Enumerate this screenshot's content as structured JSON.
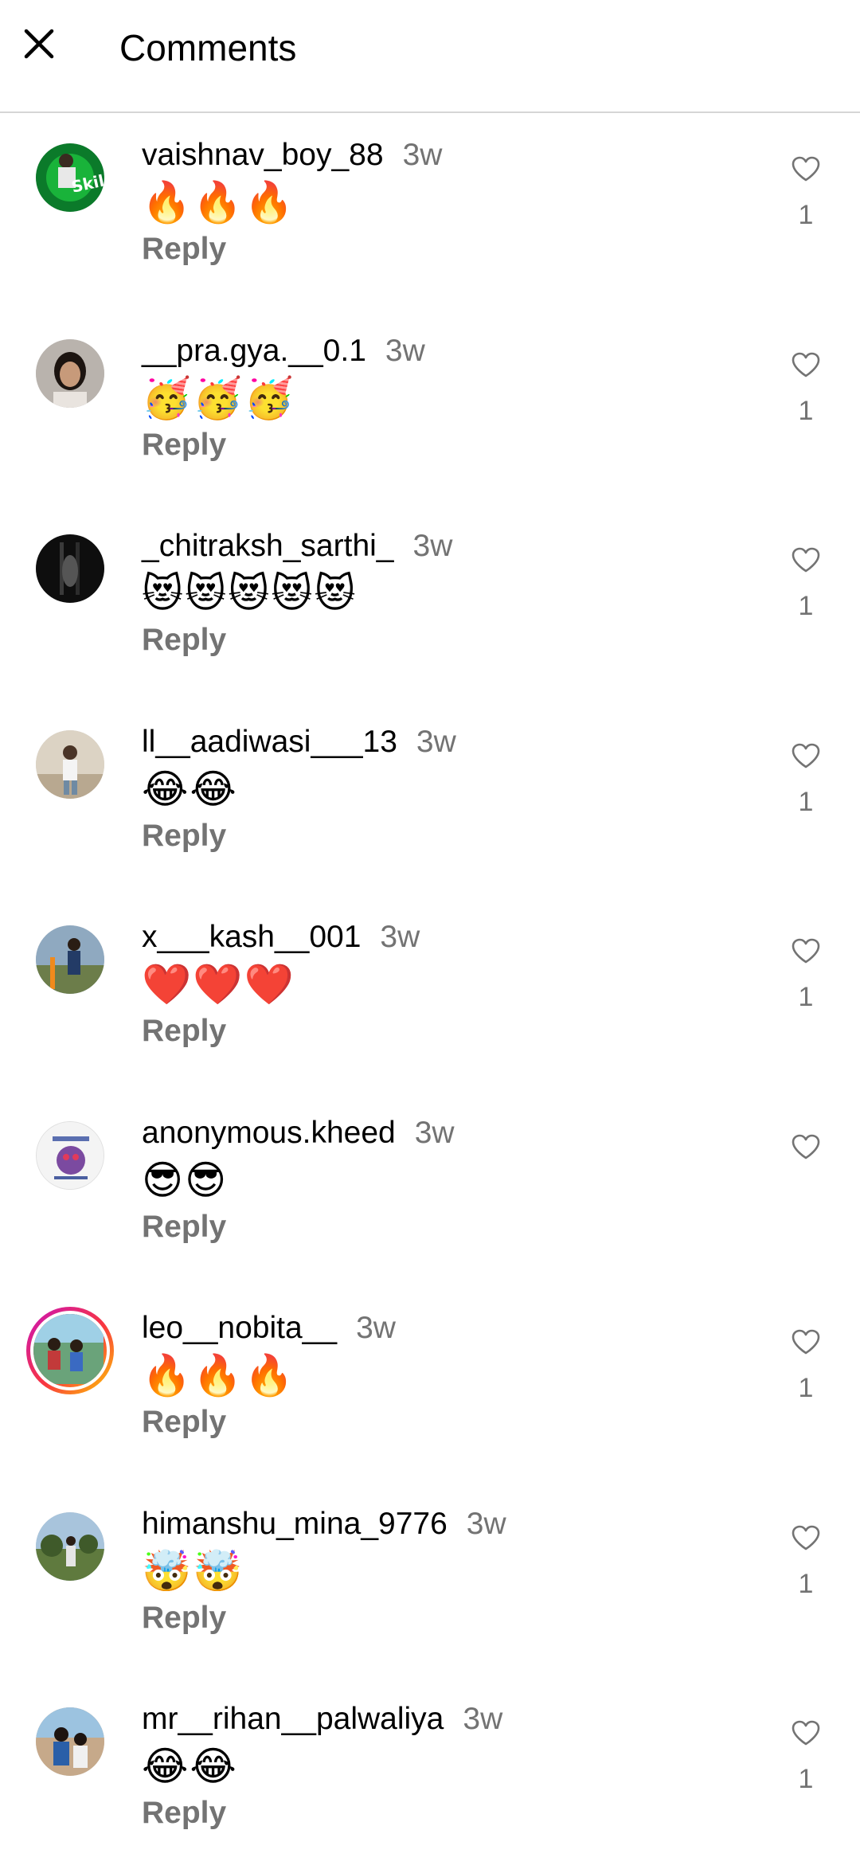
{
  "header": {
    "title": "Comments",
    "close_icon": "close-icon"
  },
  "colors": {
    "secondary_text": "#737373",
    "story_ring_start": "#c913b9",
    "story_ring_end": "#fecd00"
  },
  "comments": [
    {
      "username": "vaishnav_boy_88",
      "time": "3w",
      "text": "🔥🔥🔥",
      "reply": "Reply",
      "likes": "1"
    },
    {
      "username": "__pra.gya.__0.1",
      "time": "3w",
      "text": "🥳🥳🥳",
      "reply": "Reply",
      "likes": "1"
    },
    {
      "username": "_chitraksh_sarthi_",
      "time": "3w",
      "text": "😻😻😻😻😻",
      "reply": "Reply",
      "likes": "1"
    },
    {
      "username": "ll__aadiwasi___13",
      "time": "3w",
      "text": "😂😂",
      "reply": "Reply",
      "likes": "1"
    },
    {
      "username": "x___kash__001",
      "time": "3w",
      "text": "❤️❤️❤️",
      "reply": "Reply",
      "likes": "1"
    },
    {
      "username": "anonymous.kheed",
      "time": "3w",
      "text": "😎😎",
      "reply": "Reply",
      "likes": ""
    },
    {
      "username": "leo__nobita__",
      "time": "3w",
      "text": "🔥🔥🔥",
      "reply": "Reply",
      "likes": "1"
    },
    {
      "username": "himanshu_mina_9776",
      "time": "3w",
      "text": "🤯🤯",
      "reply": "Reply",
      "likes": "1"
    },
    {
      "username": "mr__rihan__palwaliya",
      "time": "3w",
      "text": "😂😂",
      "reply": "Reply",
      "likes": "1"
    }
  ]
}
